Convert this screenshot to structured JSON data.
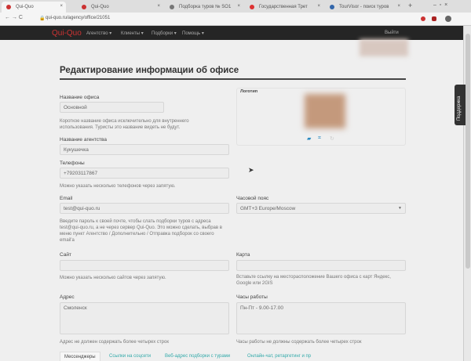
{
  "browser": {
    "tabs": [
      {
        "title": "Qui-Quo",
        "active": true
      },
      {
        "title": "Qui-Quo"
      },
      {
        "title": "Подборка туров № SO1"
      },
      {
        "title": "Государственная Трет"
      },
      {
        "title": "TourVisor - поиск туров"
      }
    ],
    "url": "qui-quo.ru/agency/office/21051"
  },
  "nav": {
    "logo": "Qui-Quo",
    "items": [
      "Агентство ▾",
      "Клиенты ▾",
      "Подборки ▾",
      "Помощь ▾"
    ],
    "logout": "Выйти"
  },
  "page": {
    "title": "Редактирование информации об офисе",
    "support": "Поддержка"
  },
  "form": {
    "office_name": {
      "label": "Название офиса",
      "value": "Основной",
      "help": "Короткое название офиса исключительно для внутреннего использования. Туристы это название видеть не будут."
    },
    "agency_name": {
      "label": "Название агентства",
      "value": "Кукушечка"
    },
    "phones": {
      "label": "Телефоны",
      "value": "+79203117867",
      "help": "Можно указать несколько телефонов через запятую."
    },
    "email": {
      "label": "Email",
      "value": "test@qui-quo.ru",
      "help": "Введите пароль к своей почте, чтобы слать подборки туров с адреса test@qui-quo.ru, а не через сервер Qui-Quo. Это можно сделать, выбрав в меню пункт Агентство / Дополнительно / Отправка подборок со своего email'а"
    },
    "site": {
      "label": "Сайт",
      "value": "",
      "help": "Можно указать несколько сайтов через запятую."
    },
    "address": {
      "label": "Адрес",
      "value": "Смоленск",
      "help": "Адрес не должен содержать более четырех строк"
    },
    "logo": {
      "label": "Логотип"
    },
    "timezone": {
      "label": "Часовой пояс",
      "value": "GMT+3 Europe/Moscow"
    },
    "map": {
      "label": "Карта",
      "value": "",
      "help": "Вставьте ссылку на месторасположение Вашего офиса с карт Яндекс, Google или 2GIS"
    },
    "hours": {
      "label": "Часы работы",
      "value": "Пн-Пт - 9.00-17.00",
      "help": "Часы работы не должны содержать более четырех строк"
    }
  },
  "bottom_tabs": [
    "Мессенджеры",
    "Ссылки на соцсети",
    "Веб-адрес подборки с турами",
    "Онлайн-чат, ретаргетинг и пр"
  ]
}
